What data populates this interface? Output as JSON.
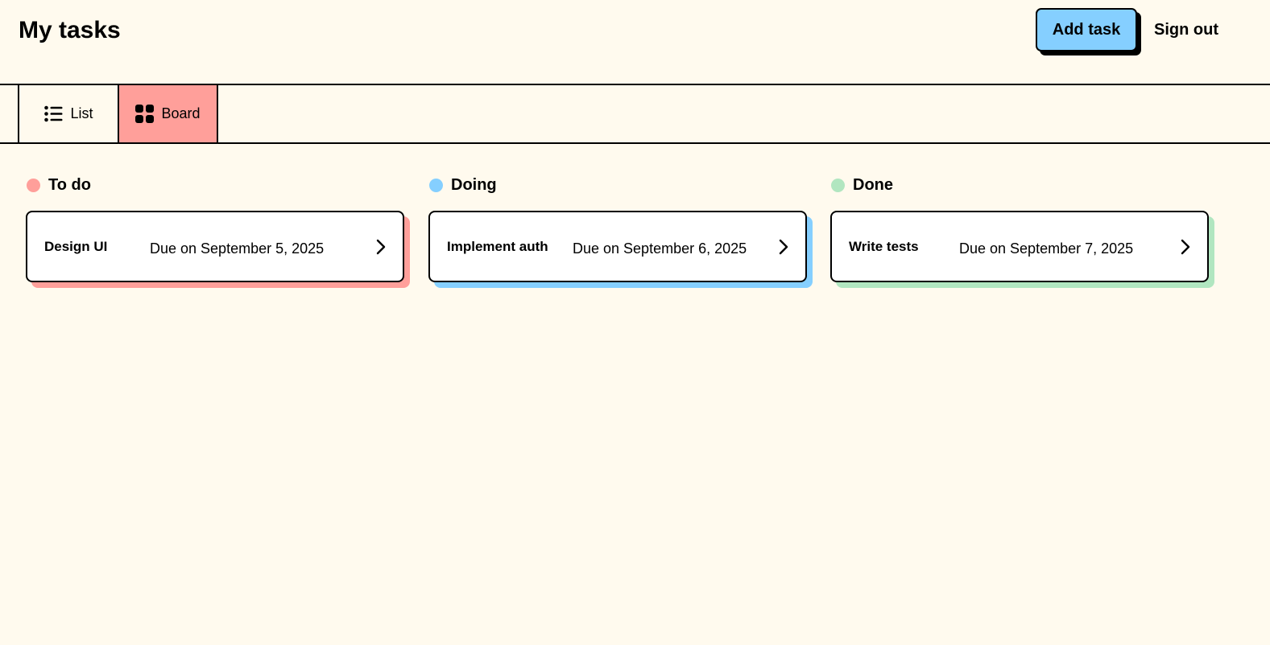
{
  "header": {
    "title": "My tasks",
    "add_task_label": "Add task",
    "sign_out_label": "Sign out",
    "add_task_color": "#85cfff"
  },
  "views": {
    "tabs": [
      {
        "label": "List",
        "icon": "list-icon",
        "active": false
      },
      {
        "label": "Board",
        "icon": "grid-icon",
        "active": true
      }
    ],
    "active_color": "#ff9f9a"
  },
  "board": {
    "columns": [
      {
        "title": "To do",
        "color": "#ff9f9a",
        "cards": [
          {
            "title": "Design UI",
            "due": "Due on September 5, 2025"
          }
        ]
      },
      {
        "title": "Doing",
        "color": "#85cfff",
        "cards": [
          {
            "title": "Implement auth",
            "due": "Due on September 6, 2025"
          }
        ]
      },
      {
        "title": "Done",
        "color": "#b1e6c0",
        "cards": [
          {
            "title": "Write tests",
            "due": "Due on September 7, 2025"
          }
        ]
      }
    ]
  }
}
